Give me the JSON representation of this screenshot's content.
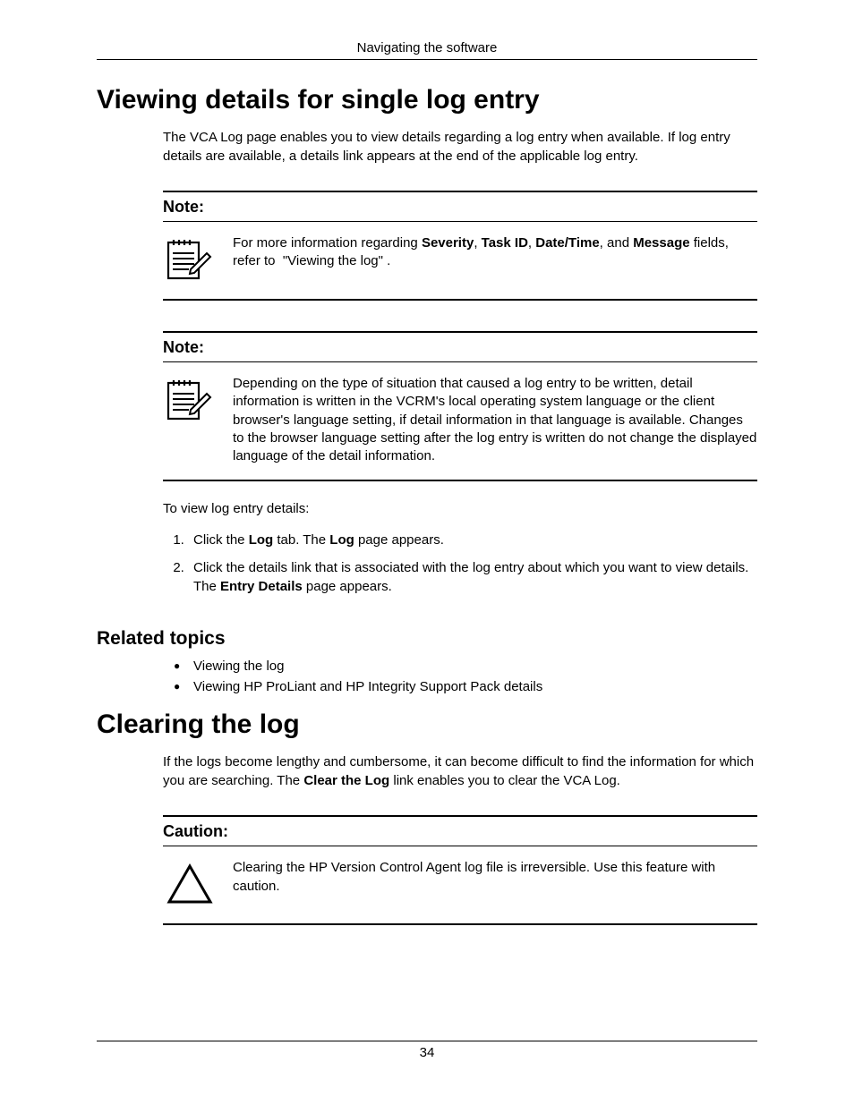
{
  "running_head": "Navigating the software",
  "page_number": "34",
  "section1": {
    "title": "Viewing details for single log entry",
    "intro": "The VCA Log page enables you to view details regarding a log entry when available. If log entry details are available, a details link appears at the end of the applicable log entry.",
    "note1": {
      "label": "Note:",
      "pre": "For more information regarding ",
      "b1": "Severity",
      "s1": ", ",
      "b2": "Task ID",
      "s2": ", ",
      "b3": "Date/Time",
      "s3": ", and ",
      "b4": "Message",
      "post": " fields, refer to ",
      "link": "\"Viewing the log\"",
      "tail": "."
    },
    "note2": {
      "label": "Note:",
      "text": "Depending on the type of situation that caused a log entry to be written, detail information is written in the VCRM's local operating system language or the client browser's language setting, if detail information in that language is available. Changes to the browser language setting after the log entry is written do not change the displayed language of the detail information."
    },
    "lead_steps": "To view log entry details:",
    "step1": {
      "pre": "Click the ",
      "b1": "Log",
      "mid": " tab. The ",
      "b2": "Log",
      "post": " page appears."
    },
    "step2": {
      "pre": "Click the details link that is associated with the log entry about which you want to view details. The ",
      "b1": "Entry Details",
      "post": " page appears."
    },
    "related_title": "Related topics",
    "related": [
      "Viewing the log",
      "Viewing HP ProLiant and HP Integrity Support Pack details"
    ]
  },
  "section2": {
    "title": "Clearing the log",
    "intro_pre": "If the logs become lengthy and cumbersome, it can become difficult to find the information for which you are searching. The ",
    "intro_b": "Clear the Log",
    "intro_post": " link enables you to clear the VCA Log.",
    "caution": {
      "label": "Caution:",
      "text": "Clearing the HP Version Control Agent log file is irreversible. Use this feature with caution."
    }
  }
}
